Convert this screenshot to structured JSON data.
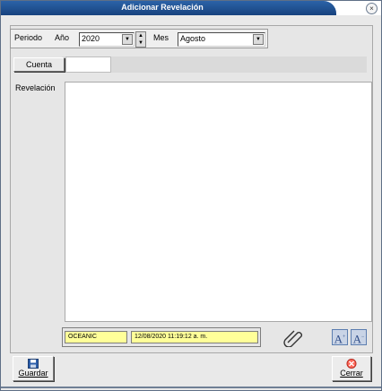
{
  "window": {
    "title": "Adicionar Revelación",
    "close_glyph": "×"
  },
  "periodo": {
    "label": "Periodo",
    "anio_label": "Año",
    "anio_value": "2020",
    "mes_label": "Mes",
    "mes_value": "Agosto"
  },
  "cuenta": {
    "button_label": "Cuenta",
    "value": ""
  },
  "revelacion": {
    "label": "Revelación",
    "value": ""
  },
  "status": {
    "user": "OCEANIC",
    "datetime": "12/08/2020 11:19:12 a. m."
  },
  "toolbar": {
    "attach_icon": "paperclip-icon",
    "font_increase_label": "A",
    "font_decrease_label": "A"
  },
  "footer": {
    "save_label": "Guardar",
    "close_label": "Cerrar"
  },
  "colors": {
    "title_bar": "#1f4e8f",
    "status_fill": "#ffff99",
    "panel_bg": "#e6e6e6"
  }
}
